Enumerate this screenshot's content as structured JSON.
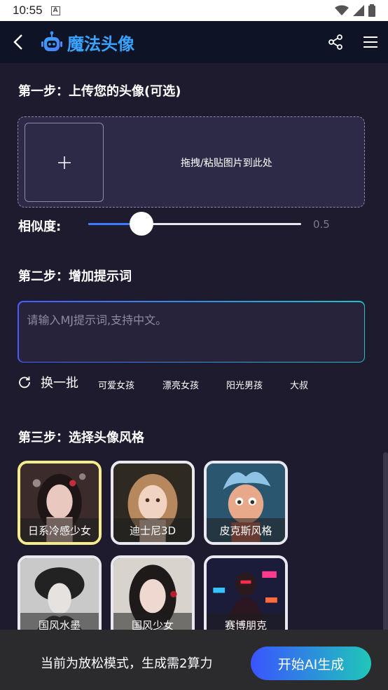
{
  "status_bar": {
    "time": "10:55",
    "a_badge": "A"
  },
  "app_bar": {
    "title": "魔法头像"
  },
  "step1": {
    "title": "第一步：上传您的头像(可选)",
    "upload_hint": "拖拽/粘贴图片到此处",
    "plus": "+"
  },
  "similarity": {
    "label": "相似度:",
    "value": 0.5,
    "value_text": "0.5",
    "min": 0,
    "max": 1
  },
  "step2": {
    "title": "第二步：增加提示词",
    "placeholder": "请输入MJ提示词,支持中文。",
    "refresh_label": "换一批",
    "tags": [
      "可爱女孩",
      "漂亮女孩",
      "阳光男孩",
      "大叔"
    ]
  },
  "step3": {
    "title": "第三步：选择头像风格",
    "styles": [
      {
        "label": "日系冷感少女",
        "selected": true
      },
      {
        "label": "迪士尼3D",
        "selected": false
      },
      {
        "label": "皮克斯风格",
        "selected": false
      },
      {
        "label": "国风水墨",
        "selected": false
      },
      {
        "label": "国风少女",
        "selected": false
      },
      {
        "label": "赛博朋克",
        "selected": false
      }
    ]
  },
  "bottom_bar": {
    "mode_text": "当前为放松模式，生成需2算力",
    "generate_label": "开始AI生成"
  },
  "colors": {
    "background": "#1e1b2e",
    "accent_blue": "#3aa3ff",
    "gradient_start": "#3a54ff",
    "gradient_end": "#1fc7b8",
    "selected_border": "#f5ec8e"
  },
  "icons": [
    "back-arrow-icon",
    "robot-logo-icon",
    "share-icon",
    "menu-icon",
    "plus-icon",
    "refresh-icon",
    "wifi-icon",
    "signal-icon",
    "battery-icon"
  ]
}
